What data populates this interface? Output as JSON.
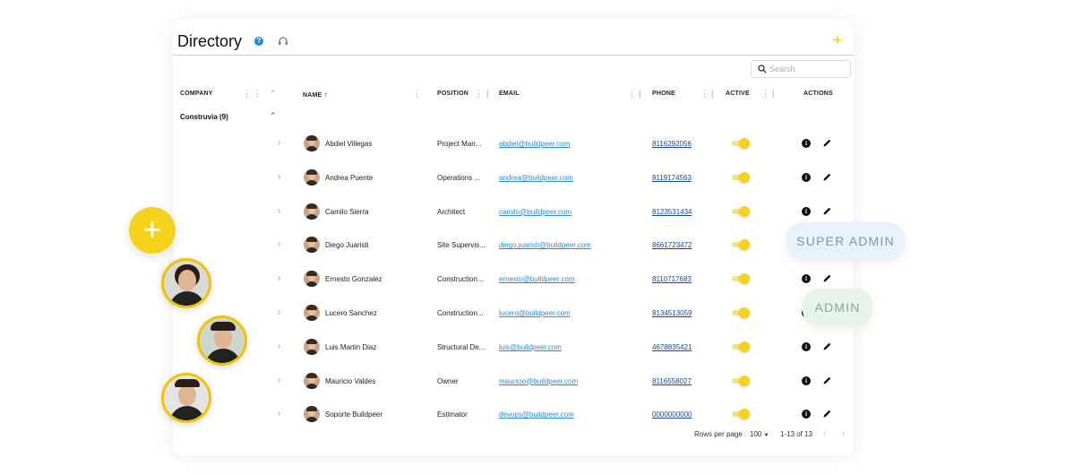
{
  "header": {
    "title": "Directory"
  },
  "search": {
    "placeholder": "Search"
  },
  "columns": [
    "COMPANY",
    "NAME",
    "POSITION",
    "EMAIL",
    "PHONE",
    "ACTIVE",
    "ACTIONS"
  ],
  "group": {
    "label": "Construvia (9)"
  },
  "rows": [
    {
      "name": "Abdiel Villegas",
      "position": "Project Man...",
      "email": "abdiel@buildpeer.com",
      "phone": "8116292056"
    },
    {
      "name": "Andrea Puente",
      "position": "Operations ...",
      "email": "andrea@buildpeer.com",
      "phone": "8119174563"
    },
    {
      "name": "Camilo Sierra",
      "position": "Architect",
      "email": "camilo@buildpeer.com",
      "phone": "8123531434"
    },
    {
      "name": "Diego Juaristi",
      "position": "Site Supervis...",
      "email": "diego.juaristi@buildpeer.com",
      "phone": "8661723472"
    },
    {
      "name": "Ernesto Gonzalez",
      "position": "Construction...",
      "email": "ernesto@buildpeer.com",
      "phone": "8110717683"
    },
    {
      "name": "Lucero Sanchez",
      "position": "Construction...",
      "email": "lucero@buildpeer.com",
      "phone": "8134513059"
    },
    {
      "name": "Luis Martin Diaz",
      "position": "Structural De...",
      "email": "luis@buildpeer.com",
      "phone": "4678835421"
    },
    {
      "name": "Mauricio Valdes",
      "position": "Owner",
      "email": "mauricio@buildpeer.com",
      "phone": "8116558027"
    },
    {
      "name": "Soporte Buildpeer",
      "position": "Estimator",
      "email": "devops@buildpeer.com",
      "phone": "0000000000"
    }
  ],
  "footer": {
    "rows_label": "Rows per page",
    "rows_value": "100",
    "range": "1-13 of 13"
  },
  "badges": {
    "super_admin": "SUPER ADMIN",
    "admin": "ADMIN"
  },
  "colors": {
    "accent": "#f7d21d",
    "email_link": "#2c8ad6",
    "phone_link": "#1a47a8"
  }
}
